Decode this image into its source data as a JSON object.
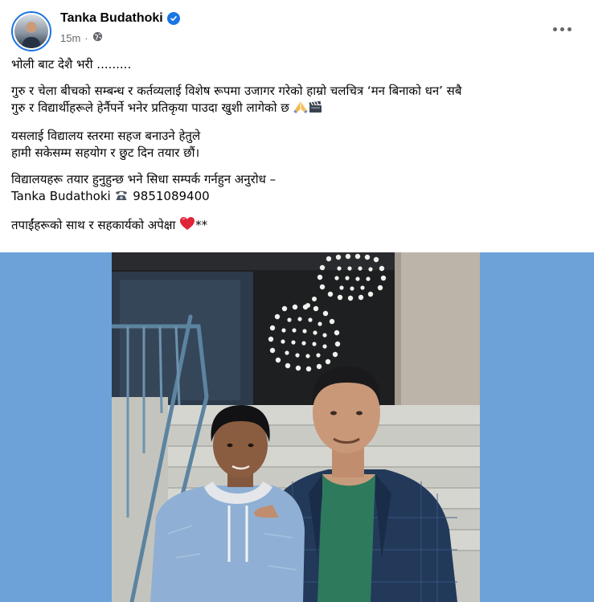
{
  "post": {
    "author": "Tanka Budathoki",
    "time": "15m",
    "paragraphs": [
      [
        "भोली बाट देशै भरी ........."
      ],
      [
        "गुरु र चेला बीचको सम्बन्ध र कर्तव्यलाई विशेष रूपमा उजागर गरेको हाम्रो चलचित्र ‘मन बिनाको धन’  सबै",
        "गुरु र विद्यार्थीहरूले हेर्नैपर्ने भनेर प्रतिकृया पाउदा खुशी लागेको छ "
      ],
      [
        "यसलाई विद्यालय स्तरमा सहज बनाउने हेतुले",
        "हामी सकेसम्म सहयोग र छुट दिन तयार छौं।"
      ],
      [
        "विद्यालयहरू तयार हुनुहुन्छ भने सिधा सम्पर्क गर्नहुन अनुरोध –",
        "Tanka Budathoki "
      ],
      [
        "तपाईंहरूको साथ र सहकार्यको अपेक्षा "
      ]
    ],
    "phone": " 9851089400",
    "ending": "**"
  },
  "colors": {
    "verified": "#1b74e4",
    "photo_background": "#6ca2d8",
    "heart": "#e0243a"
  },
  "icons": [
    "verified-badge-icon",
    "globe-icon",
    "more-options-icon",
    "folded-hands-emoji",
    "clapper-board-emoji",
    "telephone-emoji",
    "red-heart-emoji"
  ]
}
